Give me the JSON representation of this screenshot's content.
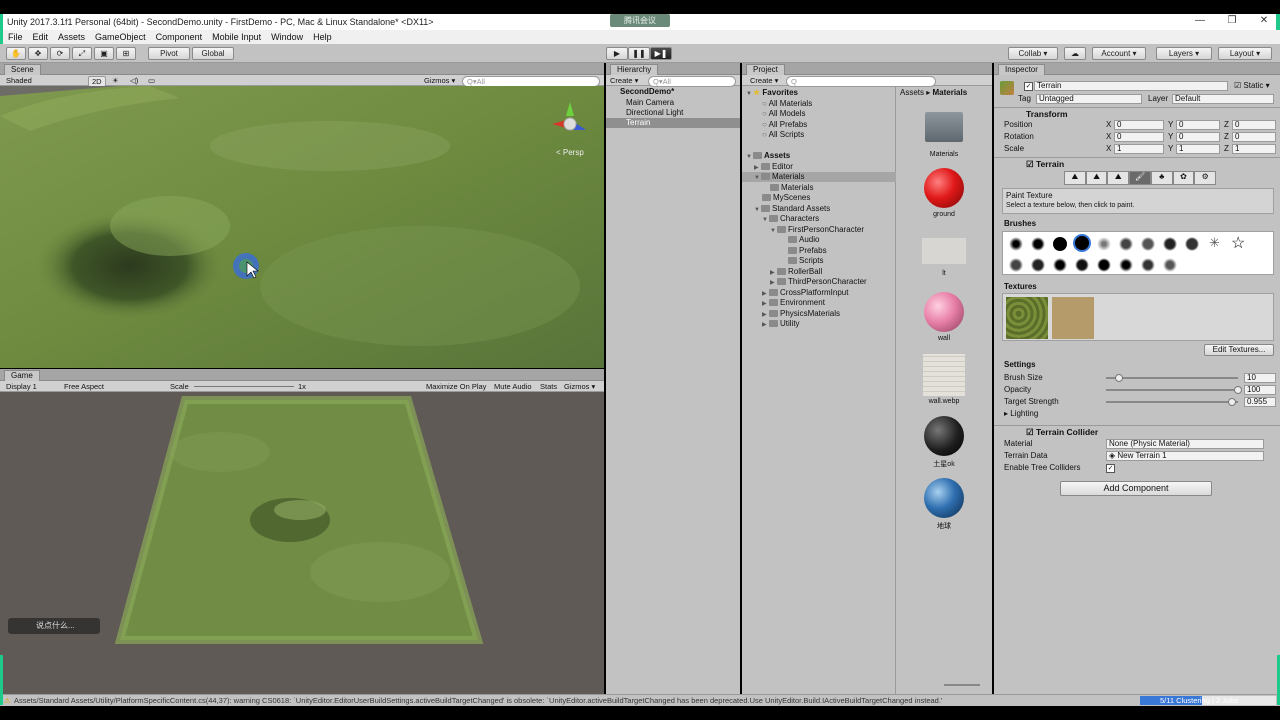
{
  "window": {
    "title": "Unity 2017.3.1f1 Personal (64bit) - SecondDemo.unity - FirstDemo - PC, Mac & Linux Standalone* <DX11>",
    "overlay_badge": "腾讯会议",
    "controls": [
      "—",
      "❐",
      "✕"
    ]
  },
  "menu": [
    "File",
    "Edit",
    "Assets",
    "GameObject",
    "Component",
    "Mobile Input",
    "Window",
    "Help"
  ],
  "toolbar": {
    "pivot": "Pivot",
    "global": "Global",
    "collab": "Collab ▾",
    "account": "Account ▾",
    "layers": "Layers ▾",
    "layout": "Layout ▾"
  },
  "scene": {
    "tab": "Scene",
    "shading": "Shaded",
    "mode_2d": "2D",
    "gizmos": "Gizmos ▾",
    "search_placeholder": "Q▾All",
    "persp": "< Persp"
  },
  "game": {
    "tab": "Game",
    "display": "Display 1",
    "aspect": "Free Aspect",
    "scale_label": "Scale",
    "scale_value": "1x",
    "maximize": "Maximize On Play",
    "mute": "Mute Audio",
    "stats": "Stats",
    "gizmos": "Gizmos ▾",
    "chat_placeholder": "说点什么..."
  },
  "hierarchy": {
    "tab": "Hierarchy",
    "create": "Create ▾",
    "search_placeholder": "Q▾All",
    "scene": "SecondDemo*",
    "items": [
      "Main Camera",
      "Directional Light",
      "Terrain"
    ],
    "selected": "Terrain"
  },
  "project": {
    "tab": "Project",
    "create": "Create ▾",
    "breadcrumb": [
      "Assets",
      "Materials"
    ],
    "favorites_label": "Favorites",
    "favorites": [
      "All Materials",
      "All Models",
      "All Prefabs",
      "All Scripts"
    ],
    "tree": [
      {
        "label": "Assets",
        "depth": 0
      },
      {
        "label": "Editor",
        "depth": 1
      },
      {
        "label": "Materials",
        "depth": 1
      },
      {
        "label": "Materials",
        "depth": 2
      },
      {
        "label": "MyScenes",
        "depth": 1
      },
      {
        "label": "Standard Assets",
        "depth": 1
      },
      {
        "label": "Characters",
        "depth": 2
      },
      {
        "label": "FirstPersonCharacter",
        "depth": 3
      },
      {
        "label": "Audio",
        "depth": 4
      },
      {
        "label": "Prefabs",
        "depth": 4
      },
      {
        "label": "Scripts",
        "depth": 4
      },
      {
        "label": "RollerBall",
        "depth": 3
      },
      {
        "label": "ThirdPersonCharacter",
        "depth": 3
      },
      {
        "label": "CrossPlatformInput",
        "depth": 2
      },
      {
        "label": "Environment",
        "depth": 2
      },
      {
        "label": "PhysicsMaterials",
        "depth": 2
      },
      {
        "label": "Utility",
        "depth": 2
      }
    ],
    "selected_tree_item": "Materials",
    "assets": [
      {
        "name": "Materials",
        "kind": "folder"
      },
      {
        "name": "ground",
        "kind": "red-sphere"
      },
      {
        "name": "lt",
        "kind": "texture-light"
      },
      {
        "name": "wall",
        "kind": "pink-sphere"
      },
      {
        "name": "wall.webp",
        "kind": "texture-tiles"
      },
      {
        "name": "土星ok",
        "kind": "dark-sphere"
      },
      {
        "name": "地球",
        "kind": "earth-sphere"
      }
    ]
  },
  "inspector": {
    "tab": "Inspector",
    "object_name": "Terrain",
    "static_label": "Static ▾",
    "tag_label": "Tag",
    "tag_value": "Untagged",
    "layer_label": "Layer",
    "layer_value": "Default",
    "transform": {
      "title": "Transform",
      "rows": [
        {
          "label": "Position",
          "x": "0",
          "y": "0",
          "z": "0"
        },
        {
          "label": "Rotation",
          "x": "0",
          "y": "0",
          "z": "0"
        },
        {
          "label": "Scale",
          "x": "1",
          "y": "1",
          "z": "1"
        }
      ]
    },
    "terrain": {
      "title": "Terrain",
      "tool_title": "Paint Texture",
      "tool_hint": "Select a texture below, then click to paint.",
      "brushes_label": "Brushes",
      "textures_label": "Textures",
      "edit_textures": "Edit Textures...",
      "settings_label": "Settings",
      "settings": [
        {
          "label": "Brush Size",
          "value": "10",
          "fraction": 0.1
        },
        {
          "label": "Opacity",
          "value": "100",
          "fraction": 1.0
        },
        {
          "label": "Target Strength",
          "value": "0.955",
          "fraction": 0.955
        }
      ],
      "lighting": "Lighting"
    },
    "collider": {
      "title": "Terrain Collider",
      "material_label": "Material",
      "material_value": "None (Physic Material)",
      "data_label": "Terrain Data",
      "data_value": "New Terrain 1",
      "tree_label": "Enable Tree Colliders"
    },
    "add_component": "Add Component"
  },
  "status": {
    "message": "Assets/Standard Assets/Utility/PlatformSpecificContent.cs(44,37): warning CS0618: `UnityEditor.EditorUserBuildSettings.activeBuildTargetChanged' is obsolete: `UnityEditor.activeBuildTargetChanged has been deprecated.Use UnityEditor.Build.IActiveBuildTargetChanged instead.'",
    "progress": "5/11 Clustering | 2 Jobs"
  }
}
